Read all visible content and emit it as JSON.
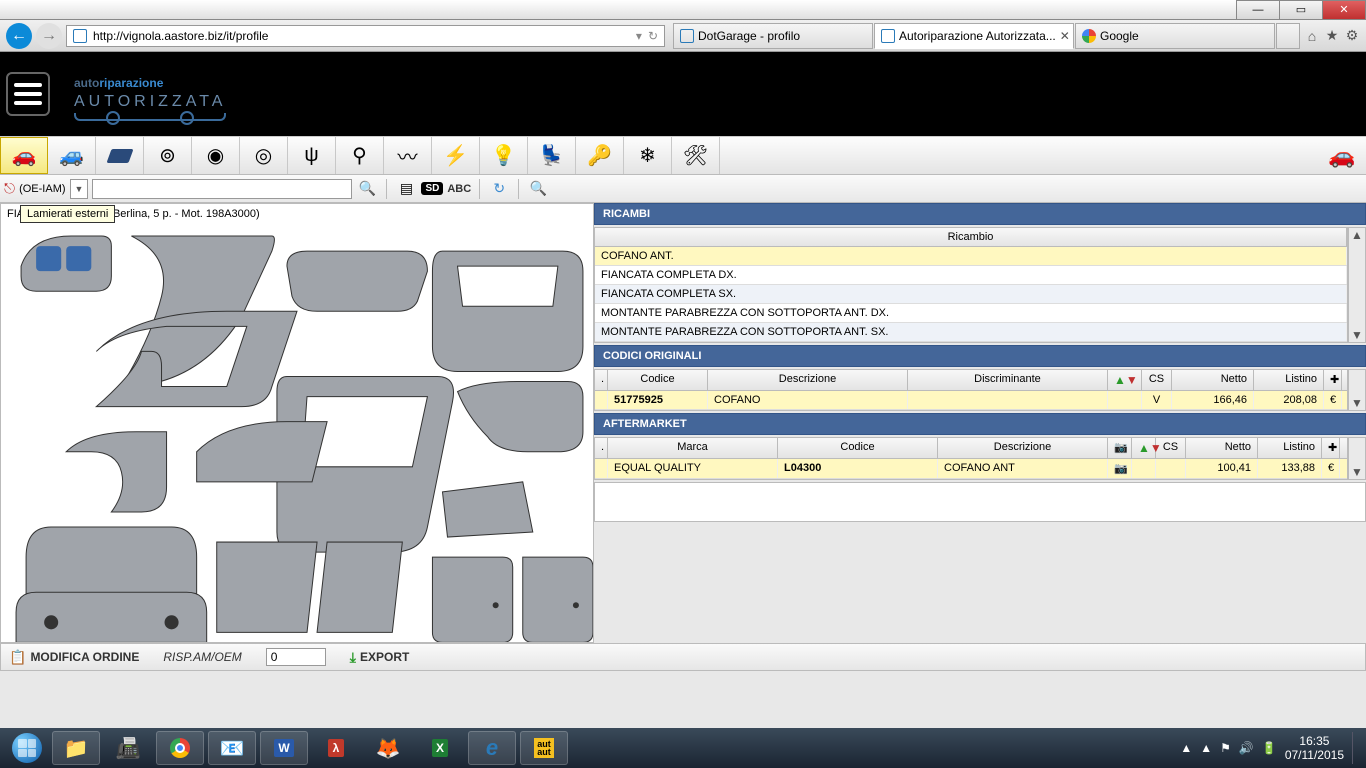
{
  "window": {
    "title": "Autoriparazione Autorizzata"
  },
  "browser": {
    "url": "http://vignola.aastore.biz/it/profile",
    "tabs": [
      {
        "label": "DotGarage - profilo",
        "active": false
      },
      {
        "label": "Autoriparazione Autorizzata...",
        "active": true
      },
      {
        "label": "Google",
        "active": false
      }
    ]
  },
  "logo": {
    "line1a": "auto",
    "line1b": "riparazione",
    "line2": "AUTORIZZATA"
  },
  "toolbar": {
    "tooltip": "Lamierati esterni",
    "dropdown_suffix": "(OE-IAM)",
    "sd": "SD",
    "abc": "ABC"
  },
  "vehicle": {
    "title": "FIAT Bravo ... 6 JTD (Berlina, 5 p. - Mot. 198A3000)"
  },
  "ricambi": {
    "header": "RICAMBI",
    "col": "Ricambio",
    "rows": [
      "COFANO ANT.",
      "FIANCATA COMPLETA DX.",
      "FIANCATA COMPLETA SX.",
      "MONTANTE PARABREZZA CON SOTTOPORTA ANT. DX.",
      "MONTANTE PARABREZZA CON SOTTOPORTA ANT. SX."
    ]
  },
  "codici": {
    "header": "CODICI ORIGINALI",
    "cols": {
      "codice": "Codice",
      "descr": "Descrizione",
      "discr": "Discriminante",
      "cs": "CS",
      "netto": "Netto",
      "listino": "Listino"
    },
    "rows": [
      {
        "codice": "51775925",
        "descr": "COFANO",
        "discr": "",
        "cs": "V",
        "netto": "166,46",
        "listino": "208,08",
        "cur": "€"
      }
    ]
  },
  "aftermarket": {
    "header": "AFTERMARKET",
    "cols": {
      "marca": "Marca",
      "codice": "Codice",
      "descr": "Descrizione",
      "cs": "CS",
      "netto": "Netto",
      "listino": "Listino"
    },
    "rows": [
      {
        "marca": "EQUAL QUALITY",
        "codice": "L04300",
        "descr": "COFANO ANT",
        "cs": "",
        "netto": "100,41",
        "listino": "133,88",
        "cur": "€"
      }
    ]
  },
  "actions": {
    "modifica": "MODIFICA ORDINE",
    "risp_label": "RISP.AM/OEM",
    "risp_value": "0",
    "export": "EXPORT"
  },
  "clock": {
    "time": "16:35",
    "date": "07/11/2015"
  }
}
